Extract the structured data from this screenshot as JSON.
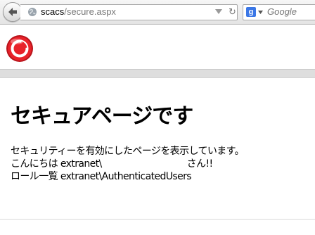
{
  "browser": {
    "url_host": "scacs",
    "url_path": "/secure.aspx",
    "search_placeholder": "Google",
    "search_engine_letter": "g"
  },
  "page": {
    "heading": "セキュアページです",
    "message": "セキュリティーを有効にしたページを表示しています。",
    "greeting_prefix": "こんにちは",
    "greeting_user": "extranet\\",
    "greeting_suffix": "さん!!",
    "roles_label": "ロール一覧",
    "roles_value": "extranet\\AuthenticatedUsers"
  },
  "colors": {
    "logo_red": "#e8222a",
    "toolbar_bg": "#ececec",
    "separator": "#dedede"
  }
}
